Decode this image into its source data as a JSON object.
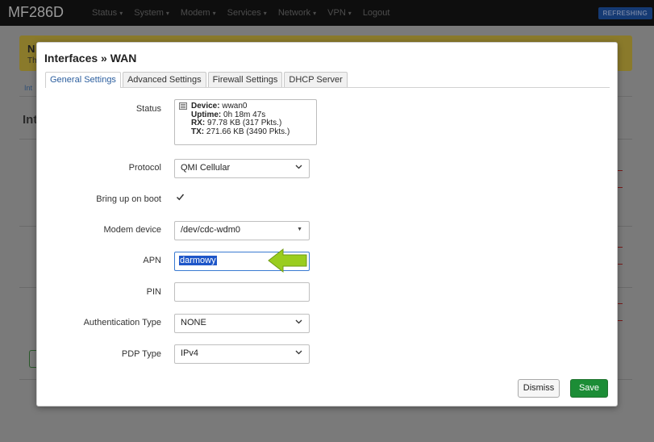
{
  "app": {
    "brand": "MF286D",
    "refresh_label": "REFRESHING"
  },
  "menu": [
    "Status",
    "System",
    "Modem",
    "Services",
    "Network",
    "VPN",
    "Logout"
  ],
  "background": {
    "alert_title": "N",
    "alert_text": "Th",
    "tab_label": "Int",
    "heading": "Int"
  },
  "modal": {
    "title": "Interfaces » WAN",
    "tabs": [
      "General Settings",
      "Advanced Settings",
      "Firewall Settings",
      "DHCP Server"
    ],
    "fields": {
      "status_label": "Status",
      "status": {
        "device_label": "Device:",
        "device": "wwan0",
        "uptime_label": "Uptime:",
        "uptime": "0h 18m 47s",
        "rx_label": "RX:",
        "rx": "97.78 KB (317 Pkts.)",
        "tx_label": "TX:",
        "tx": "271.66 KB (3490 Pkts.)"
      },
      "protocol_label": "Protocol",
      "protocol_value": "QMI Cellular",
      "bringup_label": "Bring up on boot",
      "bringup_checked": true,
      "modem_label": "Modem device",
      "modem_value": "/dev/cdc-wdm0",
      "apn_label": "APN",
      "apn_value": "darmowy",
      "pin_label": "PIN",
      "pin_value": "",
      "auth_label": "Authentication Type",
      "auth_value": "NONE",
      "pdp_label": "PDP Type",
      "pdp_value": "IPv4"
    },
    "dismiss_label": "Dismiss",
    "save_label": "Save"
  },
  "colors": {
    "arrow": "#9acd1e",
    "save": "#1c8d36",
    "selection": "#1e56c8"
  },
  "icons": {
    "device": "network-device-icon",
    "check": "checkmark-icon",
    "chevron": "chevron-down-icon",
    "arrow": "left-arrow-icon"
  }
}
